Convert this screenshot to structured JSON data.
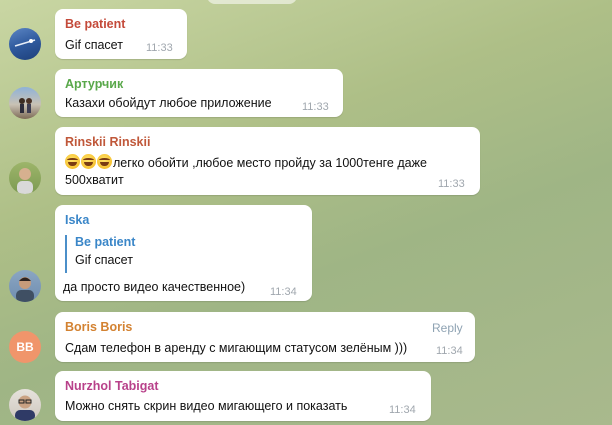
{
  "colors": {
    "name_red": "#c44a3a",
    "name_green": "#59a84a",
    "name_rinskii": "#c0583a",
    "name_iska": "#3a86c8",
    "name_boris": "#d38231",
    "name_nurzhol": "#b8418a",
    "bb_avatar": "#f0956b"
  },
  "messages": [
    {
      "id": "be-patient",
      "author": "Be patient",
      "text": "Gif спасет",
      "time": "11:33",
      "avatar_icon": "avatar-sky-photo"
    },
    {
      "id": "arturchik",
      "author": "Артурчик",
      "text": "Казахи обойдут любое приложение",
      "time": "11:33",
      "avatar_icon": "avatar-couple-photo"
    },
    {
      "id": "rinskii",
      "author": "Rinskii Rinskii",
      "text_line1": "легко обойти ,любое место пройду за 1000тенге даже",
      "text_line2": "500хватит",
      "emoji_icon": "laughing-tears-emoji-icon",
      "time": "11:33",
      "avatar_icon": "avatar-man-photo"
    },
    {
      "id": "iska",
      "author": "Iska",
      "quote_author": "Be patient",
      "quote_text": "Gif спасет",
      "text": "да просто видео качественное)",
      "time": "11:34",
      "avatar_icon": "avatar-boy-photo"
    },
    {
      "id": "boris",
      "author": "Boris Boris",
      "text": "Сдам телефон в аренду с мигающим статусом зелёным )))",
      "time": "11:34",
      "reply_label": "Reply",
      "avatar_initials": "BB"
    },
    {
      "id": "nurzhol",
      "author": "Nurzhol Tabigat",
      "text": "Можно снять скрин видео мигающего и показать",
      "time": "11:34",
      "avatar_icon": "avatar-glasses-man-photo"
    }
  ]
}
